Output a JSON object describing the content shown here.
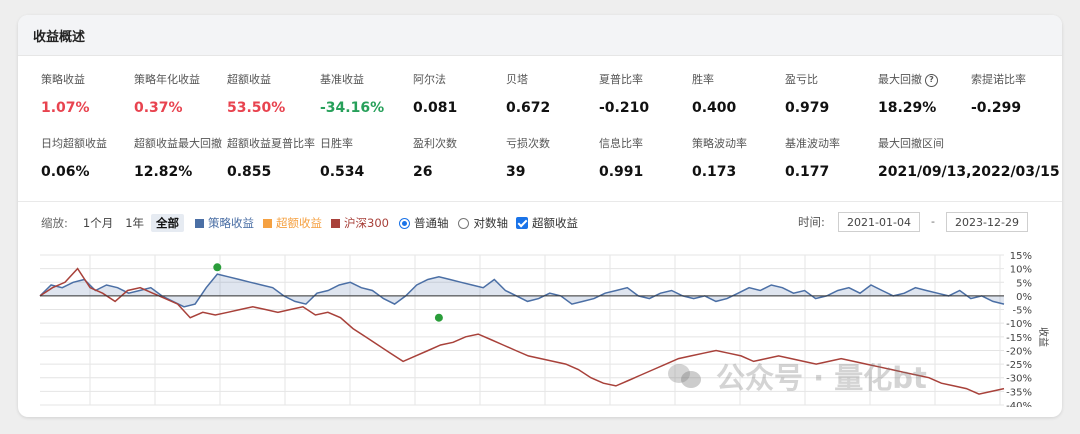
{
  "panel": {
    "title": "收益概述"
  },
  "metrics_row1": [
    {
      "label": "策略收益",
      "value": "1.07%",
      "tone": "red"
    },
    {
      "label": "策略年化收益",
      "value": "0.37%",
      "tone": "red"
    },
    {
      "label": "超额收益",
      "value": "53.50%",
      "tone": "red"
    },
    {
      "label": "基准收益",
      "value": "-34.16%",
      "tone": "green"
    },
    {
      "label": "阿尔法",
      "value": "0.081",
      "tone": ""
    },
    {
      "label": "贝塔",
      "value": "0.672",
      "tone": ""
    },
    {
      "label": "夏普比率",
      "value": "-0.210",
      "tone": ""
    },
    {
      "label": "胜率",
      "value": "0.400",
      "tone": ""
    },
    {
      "label": "盈亏比",
      "value": "0.979",
      "tone": ""
    },
    {
      "label": "最大回撤",
      "value": "18.29%",
      "tone": "",
      "help": "?"
    },
    {
      "label": "索提诺比率",
      "value": "-0.299",
      "tone": ""
    }
  ],
  "metrics_row2": [
    {
      "label": "日均超额收益",
      "value": "0.06%"
    },
    {
      "label": "超额收益最大回撤",
      "value": "12.82%"
    },
    {
      "label": "超额收益夏普比率",
      "value": "0.855"
    },
    {
      "label": "日胜率",
      "value": "0.534"
    },
    {
      "label": "盈利次数",
      "value": "26"
    },
    {
      "label": "亏损次数",
      "value": "39"
    },
    {
      "label": "信息比率",
      "value": "0.991"
    },
    {
      "label": "策略波动率",
      "value": "0.173"
    },
    {
      "label": "基准波动率",
      "value": "0.177"
    },
    {
      "label": "最大回撤区间",
      "value": "2021/09/13,2022/03/15"
    }
  ],
  "toolbar": {
    "zoom_label": "缩放:",
    "zoom_options": [
      "1个月",
      "1年",
      "全部"
    ],
    "zoom_active": "全部",
    "legend": [
      {
        "label": "策略收益",
        "color": "#4b6fa5"
      },
      {
        "label": "超额收益",
        "color": "#f5a142"
      },
      {
        "label": "沪深300",
        "color": "#a8413a"
      }
    ],
    "axis_normal": "普通轴",
    "axis_log": "对数轴",
    "excess_toggle": "超额收益",
    "time_label": "时间:",
    "start_date": "2021-01-04",
    "end_date": "2023-12-29",
    "dash": "-"
  },
  "chart_data": {
    "type": "line",
    "ylabel": "收益",
    "y_ticks": [
      "15%",
      "10%",
      "5%",
      "0%",
      "-5%",
      "-10%",
      "-15%",
      "-20%",
      "-25%",
      "-30%",
      "-35%",
      "-40%"
    ],
    "ylim": [
      -40,
      15
    ],
    "x_range": [
      "2021-01-04",
      "2023-12-29"
    ],
    "series": [
      {
        "name": "策略收益",
        "color": "#4b6fa5",
        "values": [
          0,
          4,
          3,
          5,
          6,
          2,
          4,
          3,
          1,
          2,
          3,
          0,
          -2,
          -4,
          -3,
          3,
          8,
          7,
          6,
          5,
          4,
          3,
          0,
          -2,
          -3,
          1,
          2,
          4,
          5,
          3,
          2,
          -1,
          -3,
          0,
          4,
          6,
          7,
          6,
          5,
          4,
          3,
          6,
          2,
          0,
          -2,
          -1,
          1,
          0,
          -3,
          -2,
          -1,
          1,
          2,
          3,
          0,
          -1,
          1,
          2,
          0,
          -1,
          0,
          -2,
          -1,
          1,
          3,
          2,
          4,
          3,
          1,
          2,
          -1,
          0,
          2,
          3,
          1,
          4,
          2,
          0,
          1,
          3,
          2,
          1,
          0,
          2,
          -1,
          0,
          -2,
          -3
        ]
      },
      {
        "name": "沪深300",
        "color": "#a8413a",
        "values": [
          0,
          3,
          5,
          10,
          3,
          1,
          -2,
          2,
          3,
          1,
          -1,
          -3,
          -8,
          -6,
          -7,
          -6,
          -5,
          -4,
          -5,
          -6,
          -5,
          -4,
          -7,
          -6,
          -8,
          -12,
          -15,
          -18,
          -21,
          -24,
          -22,
          -20,
          -18,
          -17,
          -15,
          -14,
          -16,
          -18,
          -20,
          -22,
          -23,
          -24,
          -25,
          -27,
          -30,
          -32,
          -33,
          -31,
          -29,
          -27,
          -25,
          -23,
          -22,
          -21,
          -20,
          -21,
          -22,
          -24,
          -23,
          -22,
          -23,
          -24,
          -25,
          -24,
          -23,
          -24,
          -25,
          -26,
          -27,
          -28,
          -29,
          -30,
          -32,
          -33,
          -34,
          -36,
          -35,
          -34
        ]
      }
    ],
    "markers": [
      {
        "series": "策略收益",
        "index": 16,
        "value": 10.5,
        "color": "#2a9d3a"
      },
      {
        "series": "策略收益",
        "index": 36,
        "value": -8,
        "color": "#2a9d3a"
      }
    ]
  },
  "watermark": "公众号 · 量化bt"
}
